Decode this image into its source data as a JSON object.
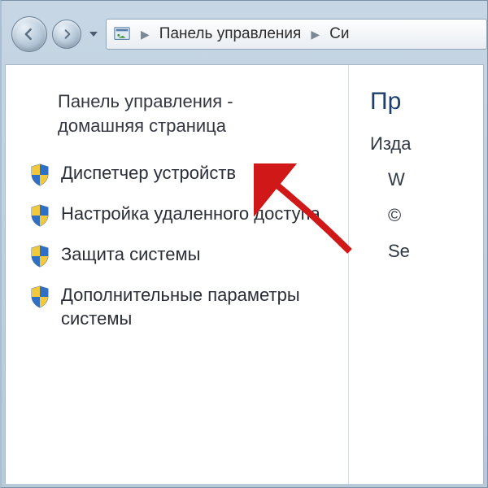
{
  "nav": {
    "breadcrumb": [
      "Панель управления",
      "Си"
    ]
  },
  "sidebar": {
    "heading_line1": "Панель управления -",
    "heading_line2": "домашняя страница",
    "tasks": [
      {
        "label": "Диспетчер устройств"
      },
      {
        "label": "Настройка удаленного доступа"
      },
      {
        "label": "Защита системы"
      },
      {
        "label": "Дополнительные параметры системы"
      }
    ]
  },
  "main": {
    "title": "Пр",
    "line1": "Изда",
    "line2": "W",
    "line3": "©",
    "line4": "Se"
  }
}
